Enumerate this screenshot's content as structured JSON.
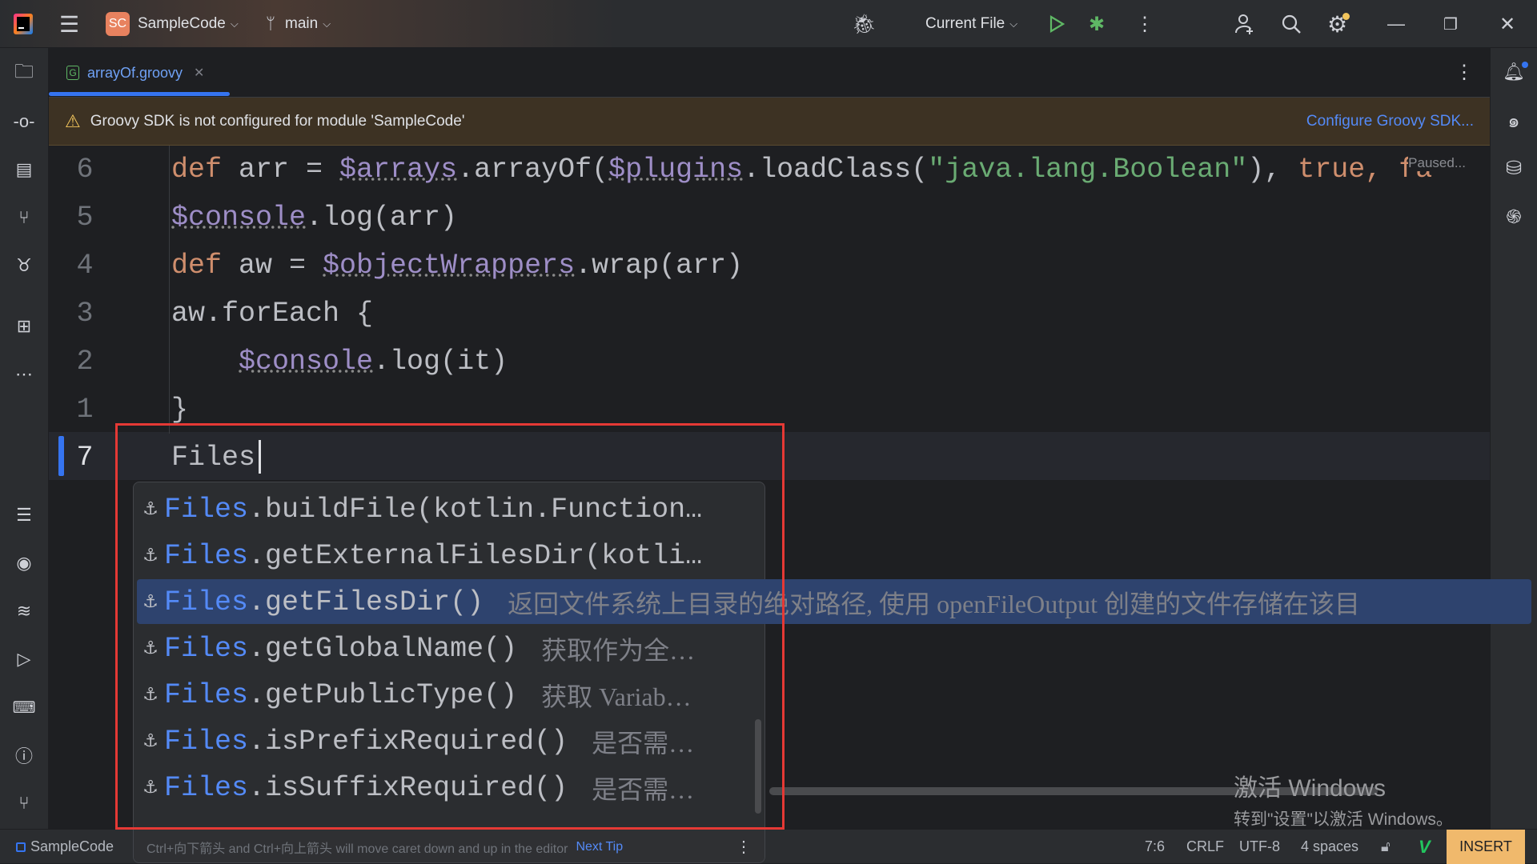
{
  "titlebar": {
    "project_badge": "SC",
    "project_name": "SampleCode",
    "branch": "main",
    "run_config": "Current File",
    "accent_badge": "#e8825f"
  },
  "tab": {
    "icon_letter": "G",
    "label": "arrayOf.groovy"
  },
  "banner": {
    "message": "Groovy SDK is not configured for module 'SampleCode'",
    "action": "Configure Groovy SDK..."
  },
  "editor": {
    "paused_label": "Paused...",
    "lines": [
      {
        "num": "6",
        "tokens": [
          {
            "t": "def ",
            "c": "k"
          },
          {
            "t": "arr = ",
            "c": "p"
          },
          {
            "t": "$arrays",
            "c": "v"
          },
          {
            "t": ".arrayOf(",
            "c": "p"
          },
          {
            "t": "$plugins",
            "c": "v"
          },
          {
            "t": ".loadClass(",
            "c": "p"
          },
          {
            "t": "\"java.lang.Boolean\"",
            "c": "s"
          },
          {
            "t": "), ",
            "c": "p"
          },
          {
            "t": "true, fa",
            "c": "k"
          }
        ]
      },
      {
        "num": "5",
        "tokens": [
          {
            "t": "$console",
            "c": "v"
          },
          {
            "t": ".log(arr)",
            "c": "p"
          }
        ]
      },
      {
        "num": "4",
        "tokens": [
          {
            "t": "def ",
            "c": "k"
          },
          {
            "t": "aw = ",
            "c": "p"
          },
          {
            "t": "$objectWrappers",
            "c": "v"
          },
          {
            "t": ".wrap(arr)",
            "c": "p"
          }
        ]
      },
      {
        "num": "3",
        "tokens": [
          {
            "t": "aw.forEach {",
            "c": "p"
          }
        ]
      },
      {
        "num": "2",
        "tokens": [
          {
            "t": "    ",
            "c": "p"
          },
          {
            "t": "$console",
            "c": "v"
          },
          {
            "t": ".log(it)",
            "c": "p"
          }
        ]
      },
      {
        "num": "1",
        "tokens": [
          {
            "t": "}",
            "c": "p"
          }
        ]
      },
      {
        "num": "7",
        "tokens": [
          {
            "t": "Files",
            "c": "p"
          }
        ]
      }
    ]
  },
  "completion": {
    "items": [
      {
        "prefix": "Files",
        "method": ".buildFile(kotlin.Function…",
        "desc": ""
      },
      {
        "prefix": "Files",
        "method": ".getExternalFilesDir(kotli…",
        "desc": ""
      },
      {
        "prefix": "Files",
        "method": ".getFilesDir()",
        "desc": "返回文件系统上目录的绝对路径, 使用 openFileOutput 创建的文件存储在该目"
      },
      {
        "prefix": "Files",
        "method": ".getGlobalName()",
        "desc": "获取作为全…"
      },
      {
        "prefix": "Files",
        "method": ".getPublicType()",
        "desc": "获取 Variab…"
      },
      {
        "prefix": "Files",
        "method": ".isPrefixRequired()",
        "desc": "是否需…"
      },
      {
        "prefix": "Files",
        "method": ".isSuffixRequired()",
        "desc": "是否需…"
      }
    ],
    "selected_index": 2,
    "tip": "Ctrl+向下箭头 and Ctrl+向上箭头 will move caret down and up in the editor",
    "next_tip": "Next Tip"
  },
  "watermark": {
    "line1": "激活 Windows",
    "line2": "转到\"设置\"以激活 Windows。"
  },
  "statusbar": {
    "project": "SampleCode",
    "position": "7:6",
    "line_ending": "CRLF",
    "encoding": "UTF-8",
    "indent": "4 spaces",
    "mode": "INSERT"
  }
}
